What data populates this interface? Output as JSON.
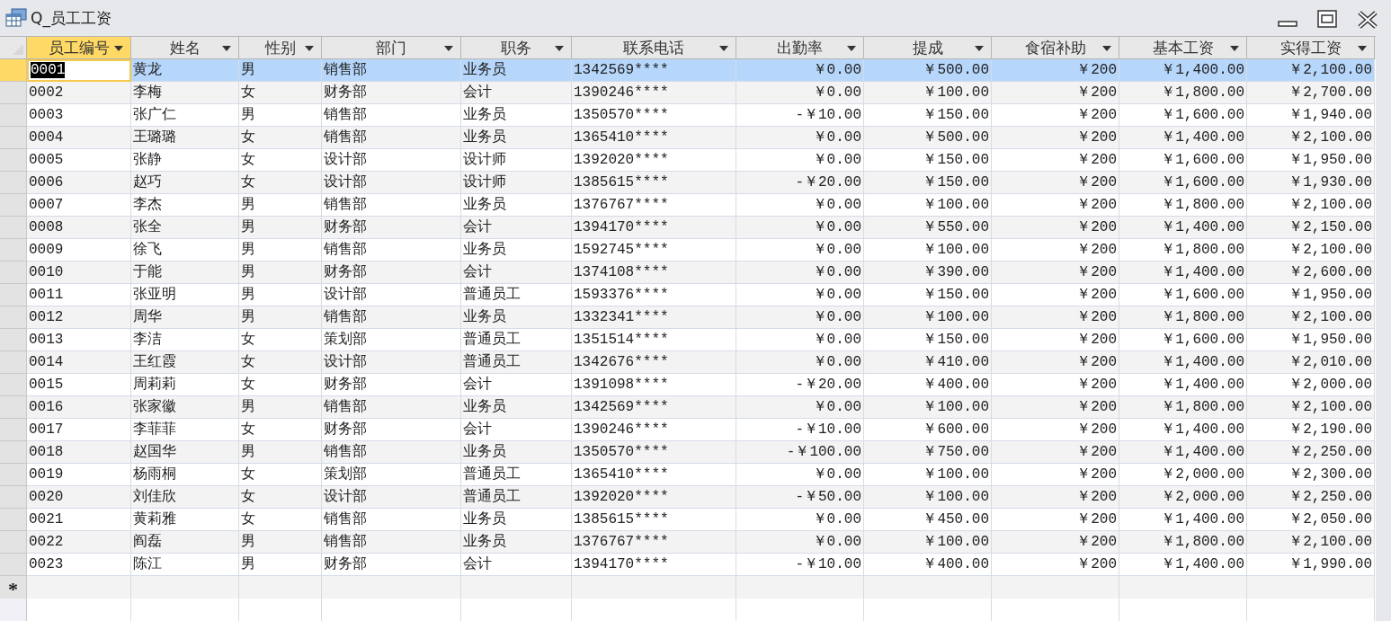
{
  "window": {
    "title": "Q_员工工资"
  },
  "columns": [
    {
      "label": "员工编号",
      "kind": "text",
      "selected": true
    },
    {
      "label": "姓名",
      "kind": "text",
      "selected": false
    },
    {
      "label": "性别",
      "kind": "text",
      "selected": false
    },
    {
      "label": "部门",
      "kind": "text",
      "selected": false
    },
    {
      "label": "职务",
      "kind": "text",
      "selected": false
    },
    {
      "label": "联系电话",
      "kind": "text",
      "selected": false
    },
    {
      "label": "出勤率",
      "kind": "currency",
      "selected": false
    },
    {
      "label": "提成",
      "kind": "currency",
      "selected": false
    },
    {
      "label": "食宿补助",
      "kind": "currency",
      "selected": false
    },
    {
      "label": "基本工资",
      "kind": "currency",
      "selected": false
    },
    {
      "label": "实得工资",
      "kind": "currency",
      "selected": false
    }
  ],
  "rows": [
    {
      "selected": true,
      "cells": [
        "0001",
        "黄龙",
        "男",
        "销售部",
        "业务员",
        "1342569****",
        "￥0.00",
        "￥500.00",
        "￥200",
        "￥1,400.00",
        "￥2,100.00"
      ]
    },
    {
      "selected": false,
      "cells": [
        "0002",
        "李梅",
        "女",
        "财务部",
        "会计",
        "1390246****",
        "￥0.00",
        "￥100.00",
        "￥200",
        "￥1,800.00",
        "￥2,700.00"
      ]
    },
    {
      "selected": false,
      "cells": [
        "0003",
        "张广仁",
        "男",
        "销售部",
        "业务员",
        "1350570****",
        "-￥10.00",
        "￥150.00",
        "￥200",
        "￥1,600.00",
        "￥1,940.00"
      ]
    },
    {
      "selected": false,
      "cells": [
        "0004",
        "王璐璐",
        "女",
        "销售部",
        "业务员",
        "1365410****",
        "￥0.00",
        "￥500.00",
        "￥200",
        "￥1,400.00",
        "￥2,100.00"
      ]
    },
    {
      "selected": false,
      "cells": [
        "0005",
        "张静",
        "女",
        "设计部",
        "设计师",
        "1392020****",
        "￥0.00",
        "￥150.00",
        "￥200",
        "￥1,600.00",
        "￥1,950.00"
      ]
    },
    {
      "selected": false,
      "cells": [
        "0006",
        "赵巧",
        "女",
        "设计部",
        "设计师",
        "1385615****",
        "-￥20.00",
        "￥150.00",
        "￥200",
        "￥1,600.00",
        "￥1,930.00"
      ]
    },
    {
      "selected": false,
      "cells": [
        "0007",
        "李杰",
        "男",
        "销售部",
        "业务员",
        "1376767****",
        "￥0.00",
        "￥100.00",
        "￥200",
        "￥1,800.00",
        "￥2,100.00"
      ]
    },
    {
      "selected": false,
      "cells": [
        "0008",
        "张全",
        "男",
        "财务部",
        "会计",
        "1394170****",
        "￥0.00",
        "￥550.00",
        "￥200",
        "￥1,400.00",
        "￥2,150.00"
      ]
    },
    {
      "selected": false,
      "cells": [
        "0009",
        "徐飞",
        "男",
        "销售部",
        "业务员",
        "1592745****",
        "￥0.00",
        "￥100.00",
        "￥200",
        "￥1,800.00",
        "￥2,100.00"
      ]
    },
    {
      "selected": false,
      "cells": [
        "0010",
        "于能",
        "男",
        "财务部",
        "会计",
        "1374108****",
        "￥0.00",
        "￥390.00",
        "￥200",
        "￥1,400.00",
        "￥2,600.00"
      ]
    },
    {
      "selected": false,
      "cells": [
        "0011",
        "张亚明",
        "男",
        "设计部",
        "普通员工",
        "1593376****",
        "￥0.00",
        "￥150.00",
        "￥200",
        "￥1,600.00",
        "￥1,950.00"
      ]
    },
    {
      "selected": false,
      "cells": [
        "0012",
        "周华",
        "男",
        "销售部",
        "业务员",
        "1332341****",
        "￥0.00",
        "￥100.00",
        "￥200",
        "￥1,800.00",
        "￥2,100.00"
      ]
    },
    {
      "selected": false,
      "cells": [
        "0013",
        "李洁",
        "女",
        "策划部",
        "普通员工",
        "1351514****",
        "￥0.00",
        "￥150.00",
        "￥200",
        "￥1,600.00",
        "￥1,950.00"
      ]
    },
    {
      "selected": false,
      "cells": [
        "0014",
        "王红霞",
        "女",
        "设计部",
        "普通员工",
        "1342676****",
        "￥0.00",
        "￥410.00",
        "￥200",
        "￥1,400.00",
        "￥2,010.00"
      ]
    },
    {
      "selected": false,
      "cells": [
        "0015",
        "周莉莉",
        "女",
        "财务部",
        "会计",
        "1391098****",
        "-￥20.00",
        "￥400.00",
        "￥200",
        "￥1,400.00",
        "￥2,000.00"
      ]
    },
    {
      "selected": false,
      "cells": [
        "0016",
        "张家徽",
        "男",
        "销售部",
        "业务员",
        "1342569****",
        "￥0.00",
        "￥100.00",
        "￥200",
        "￥1,800.00",
        "￥2,100.00"
      ]
    },
    {
      "selected": false,
      "cells": [
        "0017",
        "李菲菲",
        "女",
        "财务部",
        "会计",
        "1390246****",
        "-￥10.00",
        "￥600.00",
        "￥200",
        "￥1,400.00",
        "￥2,190.00"
      ]
    },
    {
      "selected": false,
      "cells": [
        "0018",
        "赵国华",
        "男",
        "销售部",
        "业务员",
        "1350570****",
        "-￥100.00",
        "￥750.00",
        "￥200",
        "￥1,400.00",
        "￥2,250.00"
      ]
    },
    {
      "selected": false,
      "cells": [
        "0019",
        "杨雨桐",
        "女",
        "策划部",
        "普通员工",
        "1365410****",
        "￥0.00",
        "￥100.00",
        "￥200",
        "￥2,000.00",
        "￥2,300.00"
      ]
    },
    {
      "selected": false,
      "cells": [
        "0020",
        "刘佳欣",
        "女",
        "设计部",
        "普通员工",
        "1392020****",
        "-￥50.00",
        "￥100.00",
        "￥200",
        "￥2,000.00",
        "￥2,250.00"
      ]
    },
    {
      "selected": false,
      "cells": [
        "0021",
        "黄莉雅",
        "女",
        "销售部",
        "业务员",
        "1385615****",
        "￥0.00",
        "￥450.00",
        "￥200",
        "￥1,400.00",
        "￥2,050.00"
      ]
    },
    {
      "selected": false,
      "cells": [
        "0022",
        "阎磊",
        "男",
        "销售部",
        "业务员",
        "1376767****",
        "￥0.00",
        "￥100.00",
        "￥200",
        "￥1,800.00",
        "￥2,100.00"
      ]
    },
    {
      "selected": false,
      "cells": [
        "0023",
        "陈江",
        "男",
        "财务部",
        "会计",
        "1394170****",
        "-￥10.00",
        "￥400.00",
        "￥200",
        "￥1,400.00",
        "￥1,990.00"
      ]
    }
  ],
  "new_record_marker": "*"
}
